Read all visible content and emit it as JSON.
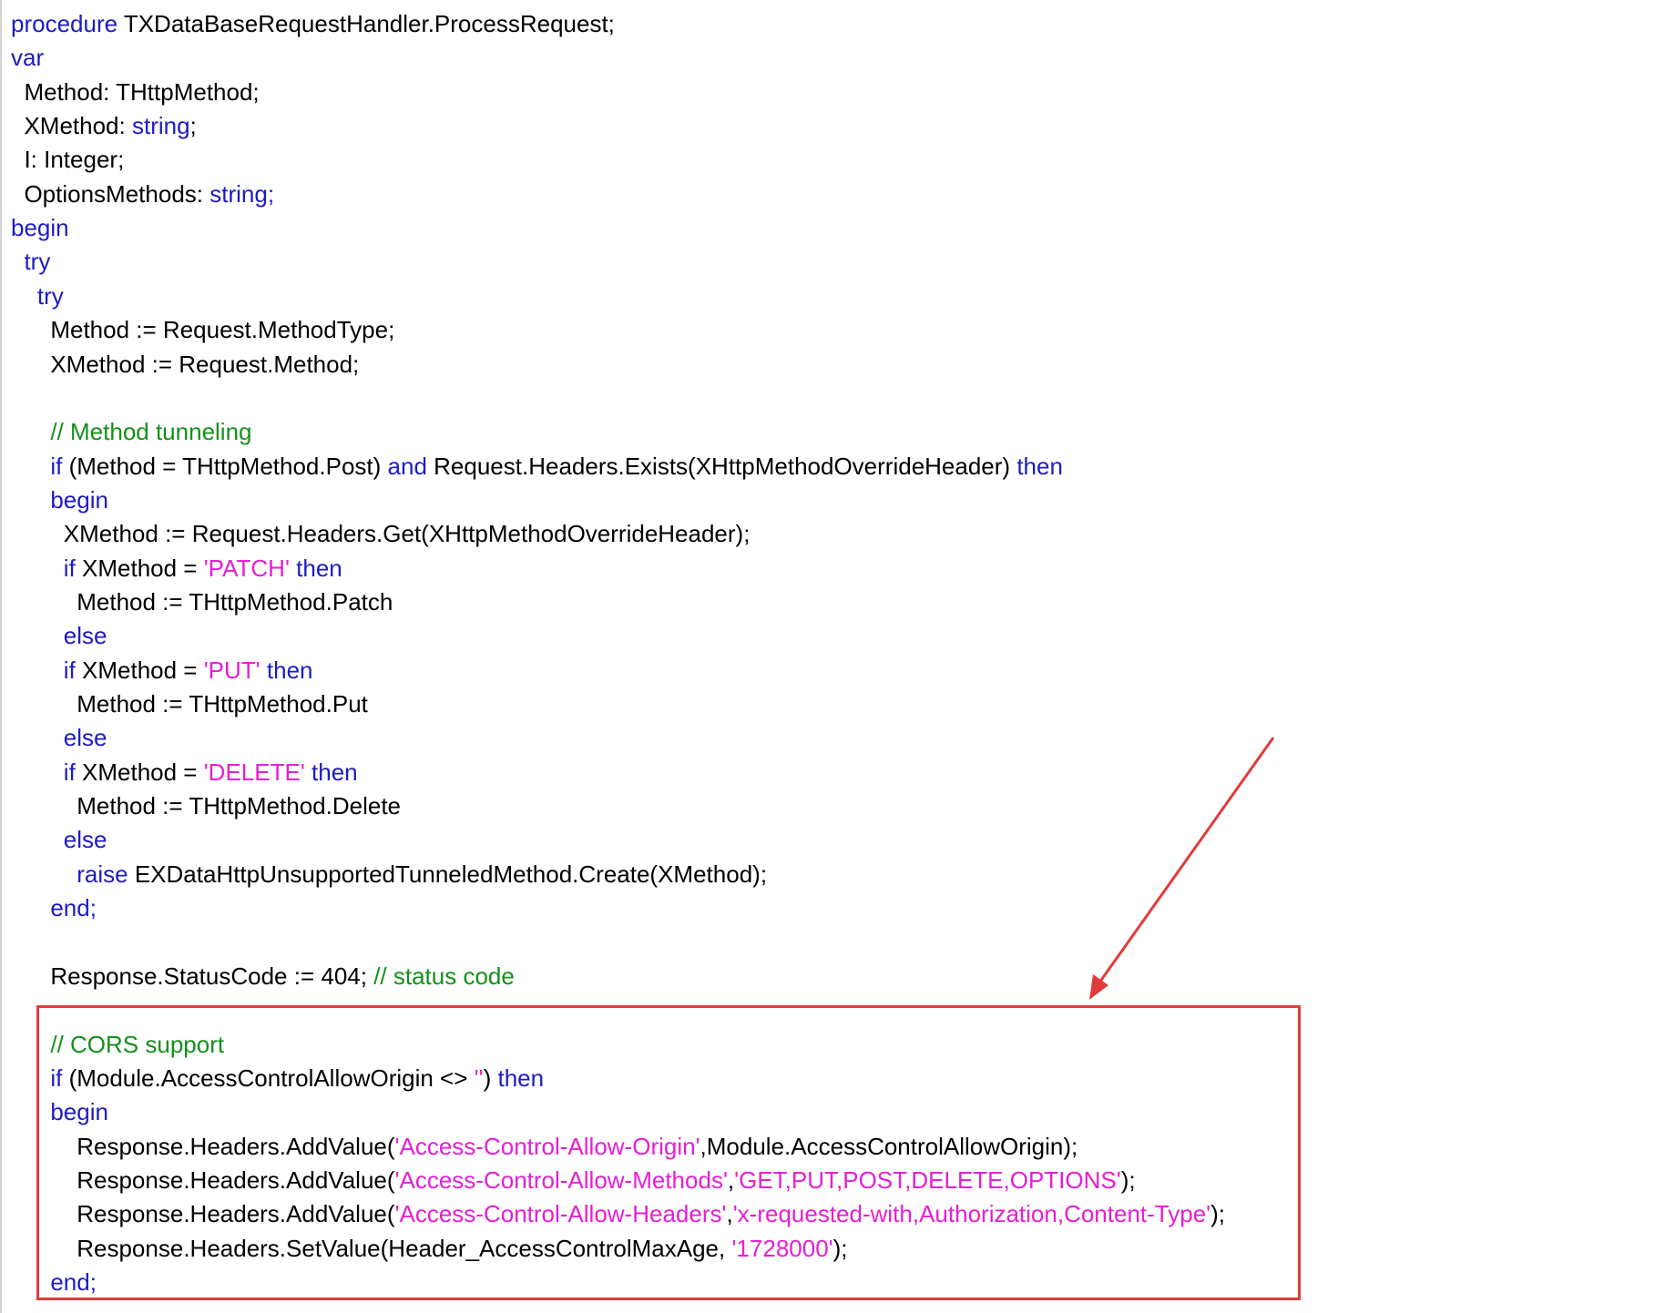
{
  "colors": {
    "keyword": "#1c1cc4",
    "string": "#e61ed3",
    "comment": "#13901a",
    "plain": "#000000",
    "highlight": "#e23b3b"
  },
  "code": {
    "lines": [
      [
        [
          "procedure",
          "kw"
        ],
        [
          " TXDataBaseRequestHandler.ProcessRequest;",
          "plain"
        ]
      ],
      [
        [
          "var",
          "kw"
        ]
      ],
      [
        [
          "  Method: THttpMethod;",
          "plain"
        ]
      ],
      [
        [
          "  XMethod: ",
          "plain"
        ],
        [
          "string",
          "kw"
        ],
        [
          ";",
          "plain"
        ]
      ],
      [
        [
          "  I: Integer;",
          "plain"
        ]
      ],
      [
        [
          "  OptionsMethods: ",
          "plain"
        ],
        [
          "string;",
          "kw"
        ]
      ],
      [
        [
          "begin",
          "kw"
        ]
      ],
      [
        [
          "  ",
          "plain"
        ],
        [
          "try",
          "kw"
        ]
      ],
      [
        [
          "    ",
          "plain"
        ],
        [
          "try",
          "kw"
        ]
      ],
      [
        [
          "      Method := Request.MethodType;",
          "plain"
        ]
      ],
      [
        [
          "      XMethod := Request.Method;",
          "plain"
        ]
      ],
      [],
      [
        [
          "      ",
          "plain"
        ],
        [
          "// Method tunneling",
          "com"
        ]
      ],
      [
        [
          "      ",
          "plain"
        ],
        [
          "if",
          "kw"
        ],
        [
          " (Method = THttpMethod.Post) ",
          "plain"
        ],
        [
          "and",
          "kw"
        ],
        [
          " Request.Headers.Exists(XHttpMethodOverrideHeader) ",
          "plain"
        ],
        [
          "then",
          "kw"
        ]
      ],
      [
        [
          "      ",
          "plain"
        ],
        [
          "begin",
          "kw"
        ]
      ],
      [
        [
          "        XMethod := Request.Headers.Get(XHttpMethodOverrideHeader);",
          "plain"
        ]
      ],
      [
        [
          "        ",
          "plain"
        ],
        [
          "if",
          "kw"
        ],
        [
          " XMethod = ",
          "plain"
        ],
        [
          "'PATCH'",
          "str"
        ],
        [
          " ",
          "plain"
        ],
        [
          "then",
          "kw"
        ]
      ],
      [
        [
          "          Method := THttpMethod.Patch",
          "plain"
        ]
      ],
      [
        [
          "        ",
          "plain"
        ],
        [
          "else",
          "kw"
        ]
      ],
      [
        [
          "        ",
          "plain"
        ],
        [
          "if",
          "kw"
        ],
        [
          " XMethod = ",
          "plain"
        ],
        [
          "'PUT'",
          "str"
        ],
        [
          " ",
          "plain"
        ],
        [
          "then",
          "kw"
        ]
      ],
      [
        [
          "          Method := THttpMethod.Put",
          "plain"
        ]
      ],
      [
        [
          "        ",
          "plain"
        ],
        [
          "else",
          "kw"
        ]
      ],
      [
        [
          "        ",
          "plain"
        ],
        [
          "if",
          "kw"
        ],
        [
          " XMethod = ",
          "plain"
        ],
        [
          "'DELETE'",
          "str"
        ],
        [
          " ",
          "plain"
        ],
        [
          "then",
          "kw"
        ]
      ],
      [
        [
          "          Method := THttpMethod.Delete",
          "plain"
        ]
      ],
      [
        [
          "        ",
          "plain"
        ],
        [
          "else",
          "kw"
        ]
      ],
      [
        [
          "          ",
          "plain"
        ],
        [
          "raise",
          "kw"
        ],
        [
          " EXDataHttpUnsupportedTunneledMethod.Create(XMethod);",
          "plain"
        ]
      ],
      [
        [
          "      ",
          "plain"
        ],
        [
          "end;",
          "kw"
        ]
      ],
      [],
      [
        [
          "      Response.StatusCode := 404; ",
          "plain"
        ],
        [
          "// status code",
          "com"
        ]
      ],
      [],
      [
        [
          "      ",
          "plain"
        ],
        [
          "// CORS support",
          "com"
        ]
      ],
      [
        [
          "      ",
          "plain"
        ],
        [
          "if",
          "kw"
        ],
        [
          " (Module.AccessControlAllowOrigin <> ",
          "plain"
        ],
        [
          "''",
          "str"
        ],
        [
          ") ",
          "plain"
        ],
        [
          "then",
          "kw"
        ]
      ],
      [
        [
          "      ",
          "plain"
        ],
        [
          "begin",
          "kw"
        ]
      ],
      [
        [
          "          Response.Headers.AddValue(",
          "plain"
        ],
        [
          "'Access-Control-Allow-Origin'",
          "str"
        ],
        [
          ",Module.AccessControlAllowOrigin);",
          "plain"
        ]
      ],
      [
        [
          "          Response.Headers.AddValue(",
          "plain"
        ],
        [
          "'Access-Control-Allow-Methods'",
          "str"
        ],
        [
          ",",
          "plain"
        ],
        [
          "'GET,PUT,POST,DELETE,OPTIONS'",
          "str"
        ],
        [
          ");",
          "plain"
        ]
      ],
      [
        [
          "          Response.Headers.AddValue(",
          "plain"
        ],
        [
          "'Access-Control-Allow-Headers'",
          "str"
        ],
        [
          ",",
          "plain"
        ],
        [
          "'x-requested-with,Authorization,Content-Type'",
          "str"
        ],
        [
          ");",
          "plain"
        ]
      ],
      [
        [
          "          Response.Headers.SetValue(Header_AccessControlMaxAge, ",
          "plain"
        ],
        [
          "'1728000'",
          "str"
        ],
        [
          ");",
          "plain"
        ]
      ],
      [
        [
          "      ",
          "plain"
        ],
        [
          "end;",
          "kw"
        ]
      ]
    ]
  }
}
